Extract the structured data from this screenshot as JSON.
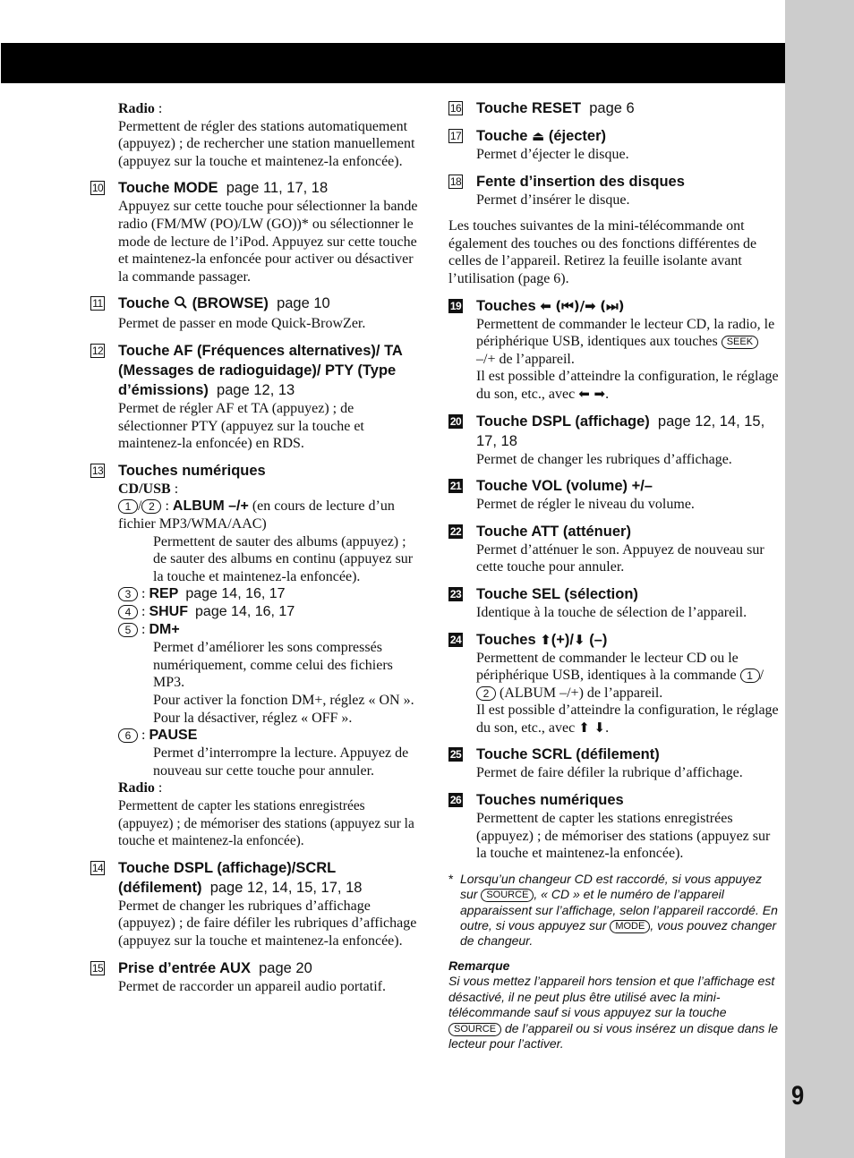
{
  "page": {
    "page_number": "9"
  },
  "left": {
    "radio_intro": {
      "label": "Radio",
      "colon": " :",
      "text": "Permettent de régler des stations automatiquement (appuyez) ; de rechercher une station manuellement (appuyez sur la touche et maintenez-la enfoncée)."
    },
    "item10": {
      "num": "10",
      "title": "Touche MODE",
      "pages": "page 11, 17, 18",
      "text": "Appuyez sur cette touche pour sélectionner la bande radio (FM/MW (PO)/LW (GO))* ou sélectionner le mode de lecture de l’iPod. Appuyez sur cette touche et maintenez-la enfoncée pour activer ou désactiver la commande passager."
    },
    "item11": {
      "num": "11",
      "title_a": "Touche",
      "icon": "search-icon",
      "title_b": "(BROWSE)",
      "pages": "page 10",
      "text": "Permet de passer en mode Quick-BrowZer."
    },
    "item12": {
      "num": "12",
      "title": "Touche AF (Fréquences alternatives)/ TA (Messages de radioguidage)/ PTY (Type d’émissions)",
      "pages": "page 12, 13",
      "text": "Permet de régler AF et TA (appuyez) ; de sélectionner PTY (appuyez sur la touche et maintenez-la enfoncée) en RDS."
    },
    "item13": {
      "num": "13",
      "title": "Touches numériques",
      "cdusb_label": "CD/USB",
      "colon": " :",
      "key1": "1",
      "key2": "2",
      "album_label": "ALBUM –/+",
      "album_note": "(en cours de lecture d’un fichier MP3/WMA/AAC)",
      "album_text": "Permettent de sauter des albums (appuyez) ; de sauter des albums en continu (appuyez sur la touche et maintenez-la enfoncée).",
      "key3": "3",
      "rep_label": "REP",
      "rep_pages": "page 14, 16, 17",
      "key4": "4",
      "shuf_label": "SHUF",
      "shuf_pages": "page 14, 16, 17",
      "key5": "5",
      "dm_label": "DM+",
      "dm_text1": "Permet d’améliorer les sons compressés numériquement, comme celui des fichiers MP3.",
      "dm_text2": "Pour activer la fonction DM+, réglez « ON ». Pour la désactiver, réglez « OFF ».",
      "key6": "6",
      "pause_label": "PAUSE",
      "pause_text": "Permet d’interrompre la lecture. Appuyez de nouveau sur cette touche pour annuler.",
      "radio_label": "Radio",
      "radio_text": "Permettent de capter les stations enregistrées (appuyez) ; de mémoriser des stations (appuyez sur la touche et maintenez-la enfoncée)."
    },
    "item14": {
      "num": "14",
      "title": "Touche DSPL (affichage)/SCRL (défilement)",
      "pages": "page 12, 14, 15, 17, 18",
      "text": "Permet de changer les rubriques d’affichage (appuyez) ; de faire défiler les rubriques d’affichage (appuyez sur la touche et maintenez-la enfoncée)."
    },
    "item15": {
      "num": "15",
      "title": "Prise d’entrée AUX",
      "pages": "page 20",
      "text": "Permet de raccorder un appareil audio portatif."
    }
  },
  "right": {
    "item16": {
      "num": "16",
      "title": "Touche RESET",
      "pages": "page 6"
    },
    "item17": {
      "num": "17",
      "title_a": "Touche",
      "icon_glyph": "⏏",
      "title_b": "(éjecter)",
      "text": "Permet d’éjecter le disque."
    },
    "item18": {
      "num": "18",
      "title": "Fente d’insertion des disques",
      "text": "Permet d’insérer le disque."
    },
    "intro": "Les touches suivantes de la mini-télécommande ont également des touches ou des fonctions différentes de celles de l’appareil. Retirez la feuille isolante avant l’utilisation (page 6).",
    "item19": {
      "num": "19",
      "title_a": "Touches",
      "left_arrow": "⬅",
      "prev_glyph": "(⏮)/",
      "right_arrow": "➡",
      "next_glyph": "(⏭)",
      "text_a": "Permettent de commander le lecteur CD, la radio, le périphérique USB, identiques aux touches",
      "seek_key": "SEEK",
      "text_b": "–/+ de l’appareil.",
      "text_c": "Il est possible d’atteindre la configuration, le réglage du son, etc., avec",
      "arrows": "⬅ ➡",
      "period": "."
    },
    "item20": {
      "num": "20",
      "title": "Touche DSPL (affichage)",
      "pages": "page 12, 14, 15, 17, 18",
      "text": "Permet de changer les rubriques d’affichage."
    },
    "item21": {
      "num": "21",
      "title": "Touche VOL (volume) +/–",
      "text": "Permet de régler le niveau du volume."
    },
    "item22": {
      "num": "22",
      "title": "Touche ATT (atténuer)",
      "text": "Permet d’atténuer le son. Appuyez de nouveau sur cette touche pour annuler."
    },
    "item23": {
      "num": "23",
      "title": "Touche SEL (sélection)",
      "text": "Identique à la touche de sélection de l’appareil."
    },
    "item24": {
      "num": "24",
      "title_a": "Touches",
      "up_arrow": "⬆",
      "plus": "(+)/",
      "down_arrow": "⬇",
      "minus": "(–)",
      "text_a": "Permettent de commander le lecteur CD ou le périphérique USB, identiques à la commande",
      "key1": "1",
      "key2": "2",
      "text_b": "(ALBUM –/+) de l’appareil.",
      "text_c": "Il est possible d’atteindre la configuration, le réglage du son, etc., avec",
      "arrows": "⬆ ⬇",
      "period": "."
    },
    "item25": {
      "num": "25",
      "title": "Touche SCRL (défilement)",
      "text": "Permet de faire défiler la rubrique d’affichage."
    },
    "item26": {
      "num": "26",
      "title": "Touches numériques",
      "text": "Permettent de capter les stations enregistrées (appuyez) ; de mémoriser des stations (appuyez sur la touche et maintenez-la enfoncée)."
    },
    "footnote": {
      "star": "*",
      "text_a": "Lorsqu’un changeur CD est raccordé, si vous appuyez sur",
      "source_key": "SOURCE",
      "text_b": ", « CD » et le numéro de l’appareil apparaissent sur l’affichage, selon l’appareil raccordé. En outre, si vous appuyez sur",
      "mode_key": "MODE",
      "text_c": ", vous pouvez changer de changeur."
    },
    "remark": {
      "title": "Remarque",
      "text_a": "Si vous mettez l’appareil hors tension et que l’affichage est désactivé, il ne peut plus être utilisé avec la mini-télécommande sauf si vous appuyez sur la touche",
      "source_key": "SOURCE",
      "text_b": "de l’appareil ou si vous insérez un disque dans le lecteur pour l’activer."
    }
  }
}
